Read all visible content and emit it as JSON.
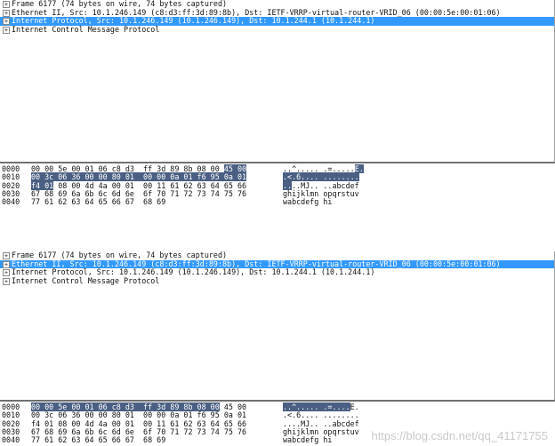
{
  "views": [
    {
      "tree": [
        {
          "text": "Frame 6177 (74 bytes on wire, 74 bytes captured)",
          "selected": false
        },
        {
          "text": "Ethernet II, Src: 10.1.246.149 (c8:d3:ff:3d:89:8b), Dst: IETF-VRRP-virtual-router-VRID_06 (00:00:5e:00:01:06)",
          "selected": false
        },
        {
          "text": "Internet Protocol, Src: 10.1.246.149 (10.1.246.149), Dst: 10.1.244.1 (10.1.244.1)",
          "selected": true
        },
        {
          "text": "Internet Control Message Protocol",
          "selected": false
        }
      ],
      "hex": [
        {
          "offset": "0000",
          "bytes": [
            {
              "t": "00 00 5e 00 01 06 c8 d3  ff 3d 89 8b 08 00 "
            },
            {
              "t": "45 00",
              "h": true
            }
          ],
          "ascii": [
            {
              "t": "..^..... .=....."
            },
            {
              "t": "E.",
              "h": true
            }
          ]
        },
        {
          "offset": "0010",
          "bytes": [
            {
              "t": "00 3c 06 36 00 00 80 01  00 00 0a 01 f6 95 0a 01",
              "h": true
            }
          ],
          "ascii": [
            {
              "t": ".<.6.... ........",
              "h": true
            }
          ]
        },
        {
          "offset": "0020",
          "bytes": [
            {
              "t": "f4 01",
              "h": true
            },
            {
              "t": " 08 00 4d 4a 00 01  00 11 61 62 63 64 65 66"
            }
          ],
          "ascii": [
            {
              "t": "..",
              "h": true
            },
            {
              "t": "..MJ.. ..abcdef"
            }
          ]
        },
        {
          "offset": "0030",
          "bytes": [
            {
              "t": "67 68 69 6a 6b 6c 6d 6e  6f 70 71 72 73 74 75 76"
            }
          ],
          "ascii": [
            {
              "t": "ghijklmn opqrstuv"
            }
          ]
        },
        {
          "offset": "0040",
          "bytes": [
            {
              "t": "77 61 62 63 64 65 66 67  68 69"
            }
          ],
          "ascii": [
            {
              "t": "wabcdefg hi"
            }
          ]
        }
      ]
    },
    {
      "tree": [
        {
          "text": "Frame 6177 (74 bytes on wire, 74 bytes captured)",
          "selected": false
        },
        {
          "text": "Ethernet II, Src: 10.1.246.149 (c8:d3:ff:3d:89:8b), Dst: IETF-VRRP-virtual-router-VRID_06 (00:00:5e:00:01:06)",
          "selected": true
        },
        {
          "text": "Internet Protocol, Src: 10.1.246.149 (10.1.246.149), Dst: 10.1.244.1 (10.1.244.1)",
          "selected": false
        },
        {
          "text": "Internet Control Message Protocol",
          "selected": false
        }
      ],
      "hex": [
        {
          "offset": "0000",
          "bytes": [
            {
              "t": "00 00 5e 00 01 06 c8 d3  ff 3d 89 8b 08 00",
              "h": true
            },
            {
              "t": " 45 00"
            }
          ],
          "ascii": [
            {
              "t": "..^..... .=....",
              "h": true
            },
            {
              "t": "E."
            }
          ]
        },
        {
          "offset": "0010",
          "bytes": [
            {
              "t": "00 3c 06 36 00 00 80 01  00 00 0a 01 f6 95 0a 01"
            }
          ],
          "ascii": [
            {
              "t": ".<.6.... ........"
            }
          ]
        },
        {
          "offset": "0020",
          "bytes": [
            {
              "t": "f4 01 08 00 4d 4a 00 01  00 11 61 62 63 64 65 66"
            }
          ],
          "ascii": [
            {
              "t": "....MJ.. ..abcdef"
            }
          ]
        },
        {
          "offset": "0030",
          "bytes": [
            {
              "t": "67 68 69 6a 6b 6c 6d 6e  6f 70 71 72 73 74 75 76"
            }
          ],
          "ascii": [
            {
              "t": "ghijklmn opqrstuv"
            }
          ]
        },
        {
          "offset": "0040",
          "bytes": [
            {
              "t": "77 61 62 63 64 65 66 67  68 69"
            }
          ],
          "ascii": [
            {
              "t": "wabcdefg hi"
            }
          ]
        }
      ]
    }
  ],
  "expander_symbol": "+",
  "watermark": "https://blog.csdn.net/qq_41171755"
}
